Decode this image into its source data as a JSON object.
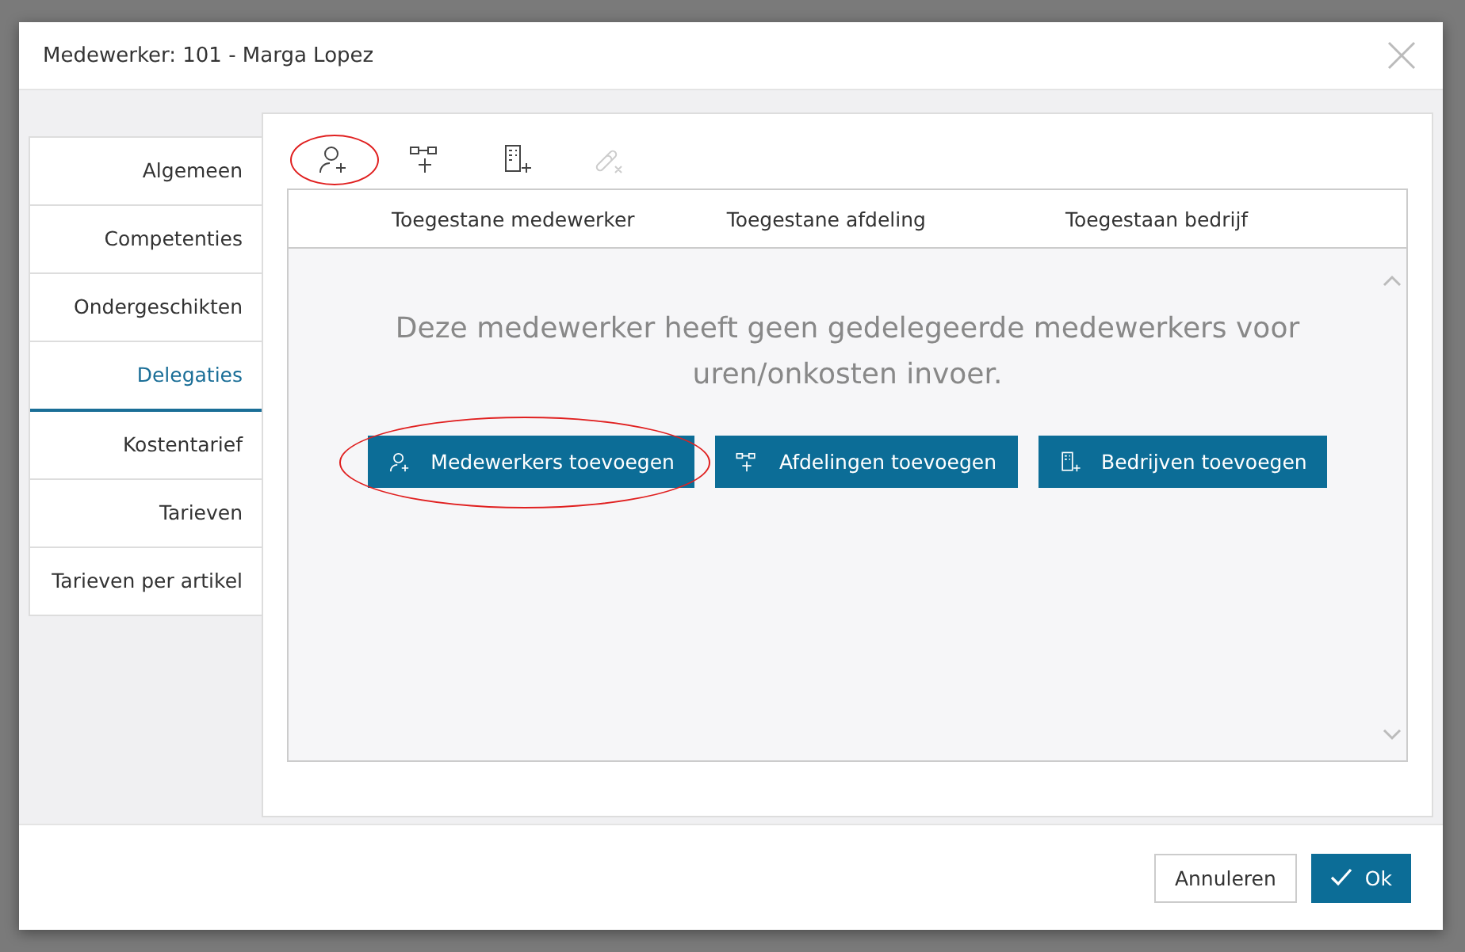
{
  "dialog": {
    "title": "Medewerker: 101 - Marga Lopez"
  },
  "tabs": [
    {
      "label": "Algemeen",
      "selected": false
    },
    {
      "label": "Competenties",
      "selected": false
    },
    {
      "label": "Ondergeschikten",
      "selected": false
    },
    {
      "label": "Delegaties",
      "selected": true
    },
    {
      "label": "Kostentarief",
      "selected": false
    },
    {
      "label": "Tarieven",
      "selected": false
    },
    {
      "label": "Tarieven per artikel",
      "selected": false
    }
  ],
  "toolbar": [
    {
      "kind": "person",
      "disabled": false,
      "highlighted": true
    },
    {
      "kind": "department",
      "disabled": false,
      "highlighted": false
    },
    {
      "kind": "company",
      "disabled": false,
      "highlighted": false
    },
    {
      "kind": "unlink",
      "disabled": true,
      "highlighted": false
    }
  ],
  "table": {
    "columns": [
      "Toegestane medewerker",
      "Toegestane afdeling",
      "Toegestaan bedrijf"
    ],
    "empty_message": "Deze medewerker heeft geen gedelegeerde medewerkers voor uren/onkosten invoer."
  },
  "actions": [
    {
      "kind": "person",
      "label": "Medewerkers toevoegen",
      "highlighted": true
    },
    {
      "kind": "department",
      "label": "Afdelingen toevoegen",
      "highlighted": false
    },
    {
      "kind": "company",
      "label": "Bedrijven toevoegen",
      "highlighted": false
    }
  ],
  "footer": {
    "cancel": "Annuleren",
    "ok": "Ok"
  }
}
